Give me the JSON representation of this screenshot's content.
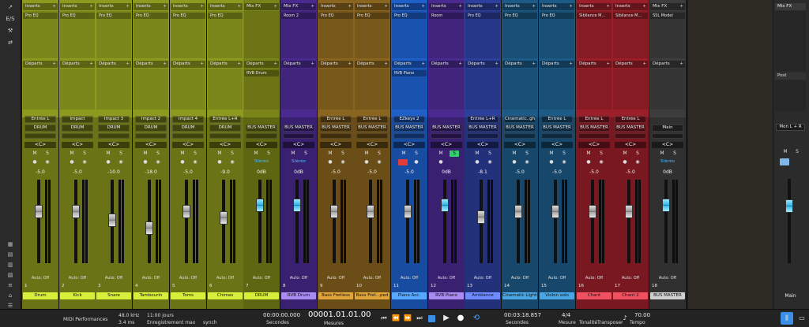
{
  "labels": {
    "inserts": "Inserts",
    "departs": "Départs",
    "mix_fx": "Mix FX",
    "post": "Post",
    "ms_m": "M",
    "ms_s": "S",
    "auto_off": "Auto: Off"
  },
  "left_tools": [
    "↗",
    "E/S",
    "⚒",
    "⇄"
  ],
  "left_tools_bottom": [
    "▦",
    "▤",
    "▥",
    "▧",
    "≡",
    "⌂",
    "☰"
  ],
  "channels": [
    {
      "color": "#8e9a1f",
      "dark": "#6a7416",
      "header": "Inserts",
      "insert": "Pro EQ",
      "send": "",
      "input": "Entrée L",
      "group": "DRUM",
      "volume": "-5.0",
      "fader": 0.62,
      "blue": false,
      "num": "1",
      "name": "Drum",
      "nameBg": "#d7ee3a",
      "scale": true
    },
    {
      "color": "#8e9a1f",
      "dark": "#6a7416",
      "header": "Inserts",
      "insert": "Pro EQ",
      "send": "",
      "input": "Impact",
      "group": "DRUM",
      "volume": "-5.0",
      "fader": 0.62,
      "blue": false,
      "num": "2",
      "name": "Kick",
      "nameBg": "#d7ee3a",
      "scale": false
    },
    {
      "color": "#8e9a1f",
      "dark": "#6a7416",
      "header": "Inserts",
      "insert": "Pro EQ",
      "send": "",
      "input": "Impact 3",
      "group": "DRUM",
      "volume": "-10.0",
      "fader": 0.52,
      "blue": false,
      "num": "3",
      "name": "Snare",
      "nameBg": "#d7ee3a",
      "scale": false
    },
    {
      "color": "#8e9a1f",
      "dark": "#6a7416",
      "header": "Inserts",
      "insert": "Pro EQ",
      "send": "",
      "input": "Impact 2",
      "group": "DRUM",
      "volume": "-18.0",
      "fader": 0.42,
      "blue": false,
      "num": "4",
      "name": "Tambourin",
      "nameBg": "#d7ee3a",
      "scale": false
    },
    {
      "color": "#8e9a1f",
      "dark": "#6a7416",
      "header": "Inserts",
      "insert": "Pro EQ",
      "send": "",
      "input": "Impact 4",
      "group": "DRUM",
      "volume": "-5.0",
      "fader": 0.62,
      "blue": false,
      "num": "5",
      "name": "Toms",
      "nameBg": "#d7ee3a",
      "scale": false
    },
    {
      "color": "#8e9a1f",
      "dark": "#6a7416",
      "header": "Inserts",
      "insert": "Pro EQ",
      "send": "",
      "input": "Entrée L+R",
      "group": "DRUM",
      "volume": "-9.0",
      "fader": 0.55,
      "blue": false,
      "num": "6",
      "name": "Chimes",
      "nameBg": "#d7ee3a",
      "scale": false
    },
    {
      "color": "#7b8418",
      "dark": "#5f6612",
      "header": "Mix FX",
      "insert": "",
      "send": "RVB Drum",
      "input": "",
      "group": "BUS MASTER",
      "volume": "0dB",
      "fader": 0.7,
      "blue": true,
      "num": "7",
      "name": "DRUM",
      "nameBg": "#d7ee3a",
      "scale": false
    },
    {
      "color": "#4a2a8e",
      "dark": "#3a2070",
      "header": "Mix FX",
      "insert": "Room 2",
      "send": "",
      "input": "",
      "group": "BUS MASTER",
      "volume": "0dB",
      "fader": 0.7,
      "blue": true,
      "num": "8",
      "name": "RVB Drum",
      "nameBg": "#a98af0",
      "scale": false
    },
    {
      "color": "#8a6520",
      "dark": "#6b4e17",
      "header": "Inserts",
      "insert": "Pro EQ",
      "send": "",
      "input": "Entrée L",
      "group": "BUS MASTER",
      "volume": "-5.0",
      "fader": 0.62,
      "blue": false,
      "num": "9",
      "name": "Bass Fretless",
      "nameBg": "#e0a43a",
      "scale": false
    },
    {
      "color": "#8a6520",
      "dark": "#6b4e17",
      "header": "Inserts",
      "insert": "Pro EQ",
      "send": "",
      "input": "Entrée L",
      "group": "BUS MASTER",
      "volume": "-5.0",
      "fader": 0.62,
      "blue": false,
      "num": "10",
      "name": "Bass Fret...ped",
      "nameBg": "#e0a43a",
      "scale": false
    },
    {
      "color": "#1e5fc8",
      "dark": "#184ca0",
      "header": "Inserts",
      "insert": "Pro EQ",
      "send": "RVB Piano",
      "input": "EZkeys 2",
      "group": "BUS MASTER",
      "volume": "-5.0",
      "fader": 0.62,
      "blue": false,
      "num": "11",
      "name": "Piano Acc.",
      "nameBg": "#58a8ff",
      "scale": false
    },
    {
      "color": "#4a2a8e",
      "dark": "#3a2070",
      "header": "Inserts",
      "insert": "Room",
      "send": "",
      "input": "",
      "group": "BUS MASTER",
      "volume": "0dB",
      "fader": 0.7,
      "blue": true,
      "num": "12",
      "name": "RVB Piano",
      "nameBg": "#a98af0",
      "scale": false
    },
    {
      "color": "#2c3f9a",
      "dark": "#22317a",
      "header": "Inserts",
      "insert": "Pro EQ",
      "send": "",
      "input": "Entrée L+R",
      "group": "BUS MASTER",
      "volume": "-8.1",
      "fader": 0.56,
      "blue": false,
      "num": "13",
      "name": "Ambiance",
      "nameBg": "#6f8aff",
      "scale": false
    },
    {
      "color": "#1d5a86",
      "dark": "#17476a",
      "header": "Inserts",
      "insert": "Pro EQ",
      "send": "",
      "input": "Cinematic..ghts",
      "group": "BUS MASTER",
      "volume": "-5.0",
      "fader": 0.62,
      "blue": false,
      "num": "14",
      "name": "Cinematic Lights",
      "nameBg": "#4aa6e2",
      "scale": false
    },
    {
      "color": "#1d5a86",
      "dark": "#17476a",
      "header": "Inserts",
      "insert": "Pro EQ",
      "send": "",
      "input": "Entrée L",
      "group": "BUS MASTER",
      "volume": "-5.0",
      "fader": 0.62,
      "blue": false,
      "num": "15",
      "name": "Violon solo",
      "nameBg": "#4aa6e2",
      "scale": false
    },
    {
      "color": "#9a1f2a",
      "dark": "#7a1821",
      "header": "Inserts",
      "insert": "Sibilance M...",
      "send": "",
      "input": "Entrée L",
      "group": "BUS MASTER",
      "volume": "-5.0",
      "fader": 0.62,
      "blue": false,
      "num": "16",
      "name": "Chant",
      "nameBg": "#f05060",
      "scale": false
    },
    {
      "color": "#9a1f2a",
      "dark": "#7a1821",
      "header": "Inserts",
      "insert": "Sibilance M...",
      "send": "",
      "input": "Entrée L",
      "group": "BUS MASTER",
      "volume": "-5.0",
      "fader": 0.62,
      "blue": false,
      "num": "17",
      "name": "Chant 2",
      "nameBg": "#f05060",
      "scale": false
    },
    {
      "color": "#3d3d3d",
      "dark": "#303030",
      "header": "Mix FX",
      "insert": "SSL Model",
      "send": "",
      "input": "",
      "group": "Main",
      "volume": "0dB",
      "fader": 0.7,
      "blue": true,
      "num": "18",
      "name": "BUS MASTER",
      "nameBg": "#cfcfcf",
      "scale": false
    }
  ],
  "main": {
    "header": "Mix FX",
    "post": "Post",
    "output": "Mon L + R",
    "name": "Main"
  },
  "transport": {
    "midi_performances": "MIDI Performances",
    "sample_rate": "48.0 kHz",
    "latency": "3.4 ms",
    "record_days": "11:00 jours",
    "record_max": "Enregistrement max",
    "sync": "synch",
    "time_seconds": "00:00:00.000",
    "seconds_label": "Secondes",
    "position": "00001.01.01.00",
    "measures_label": "Mesures",
    "end_time": "00:03:18.857",
    "end_label": "Secondes",
    "signature": "4/4",
    "signature_label": "Mesure",
    "key_label": "Tonalité",
    "transpose_label": "Transposer",
    "tempo_label": "Tempo",
    "tempo": "70.00"
  }
}
